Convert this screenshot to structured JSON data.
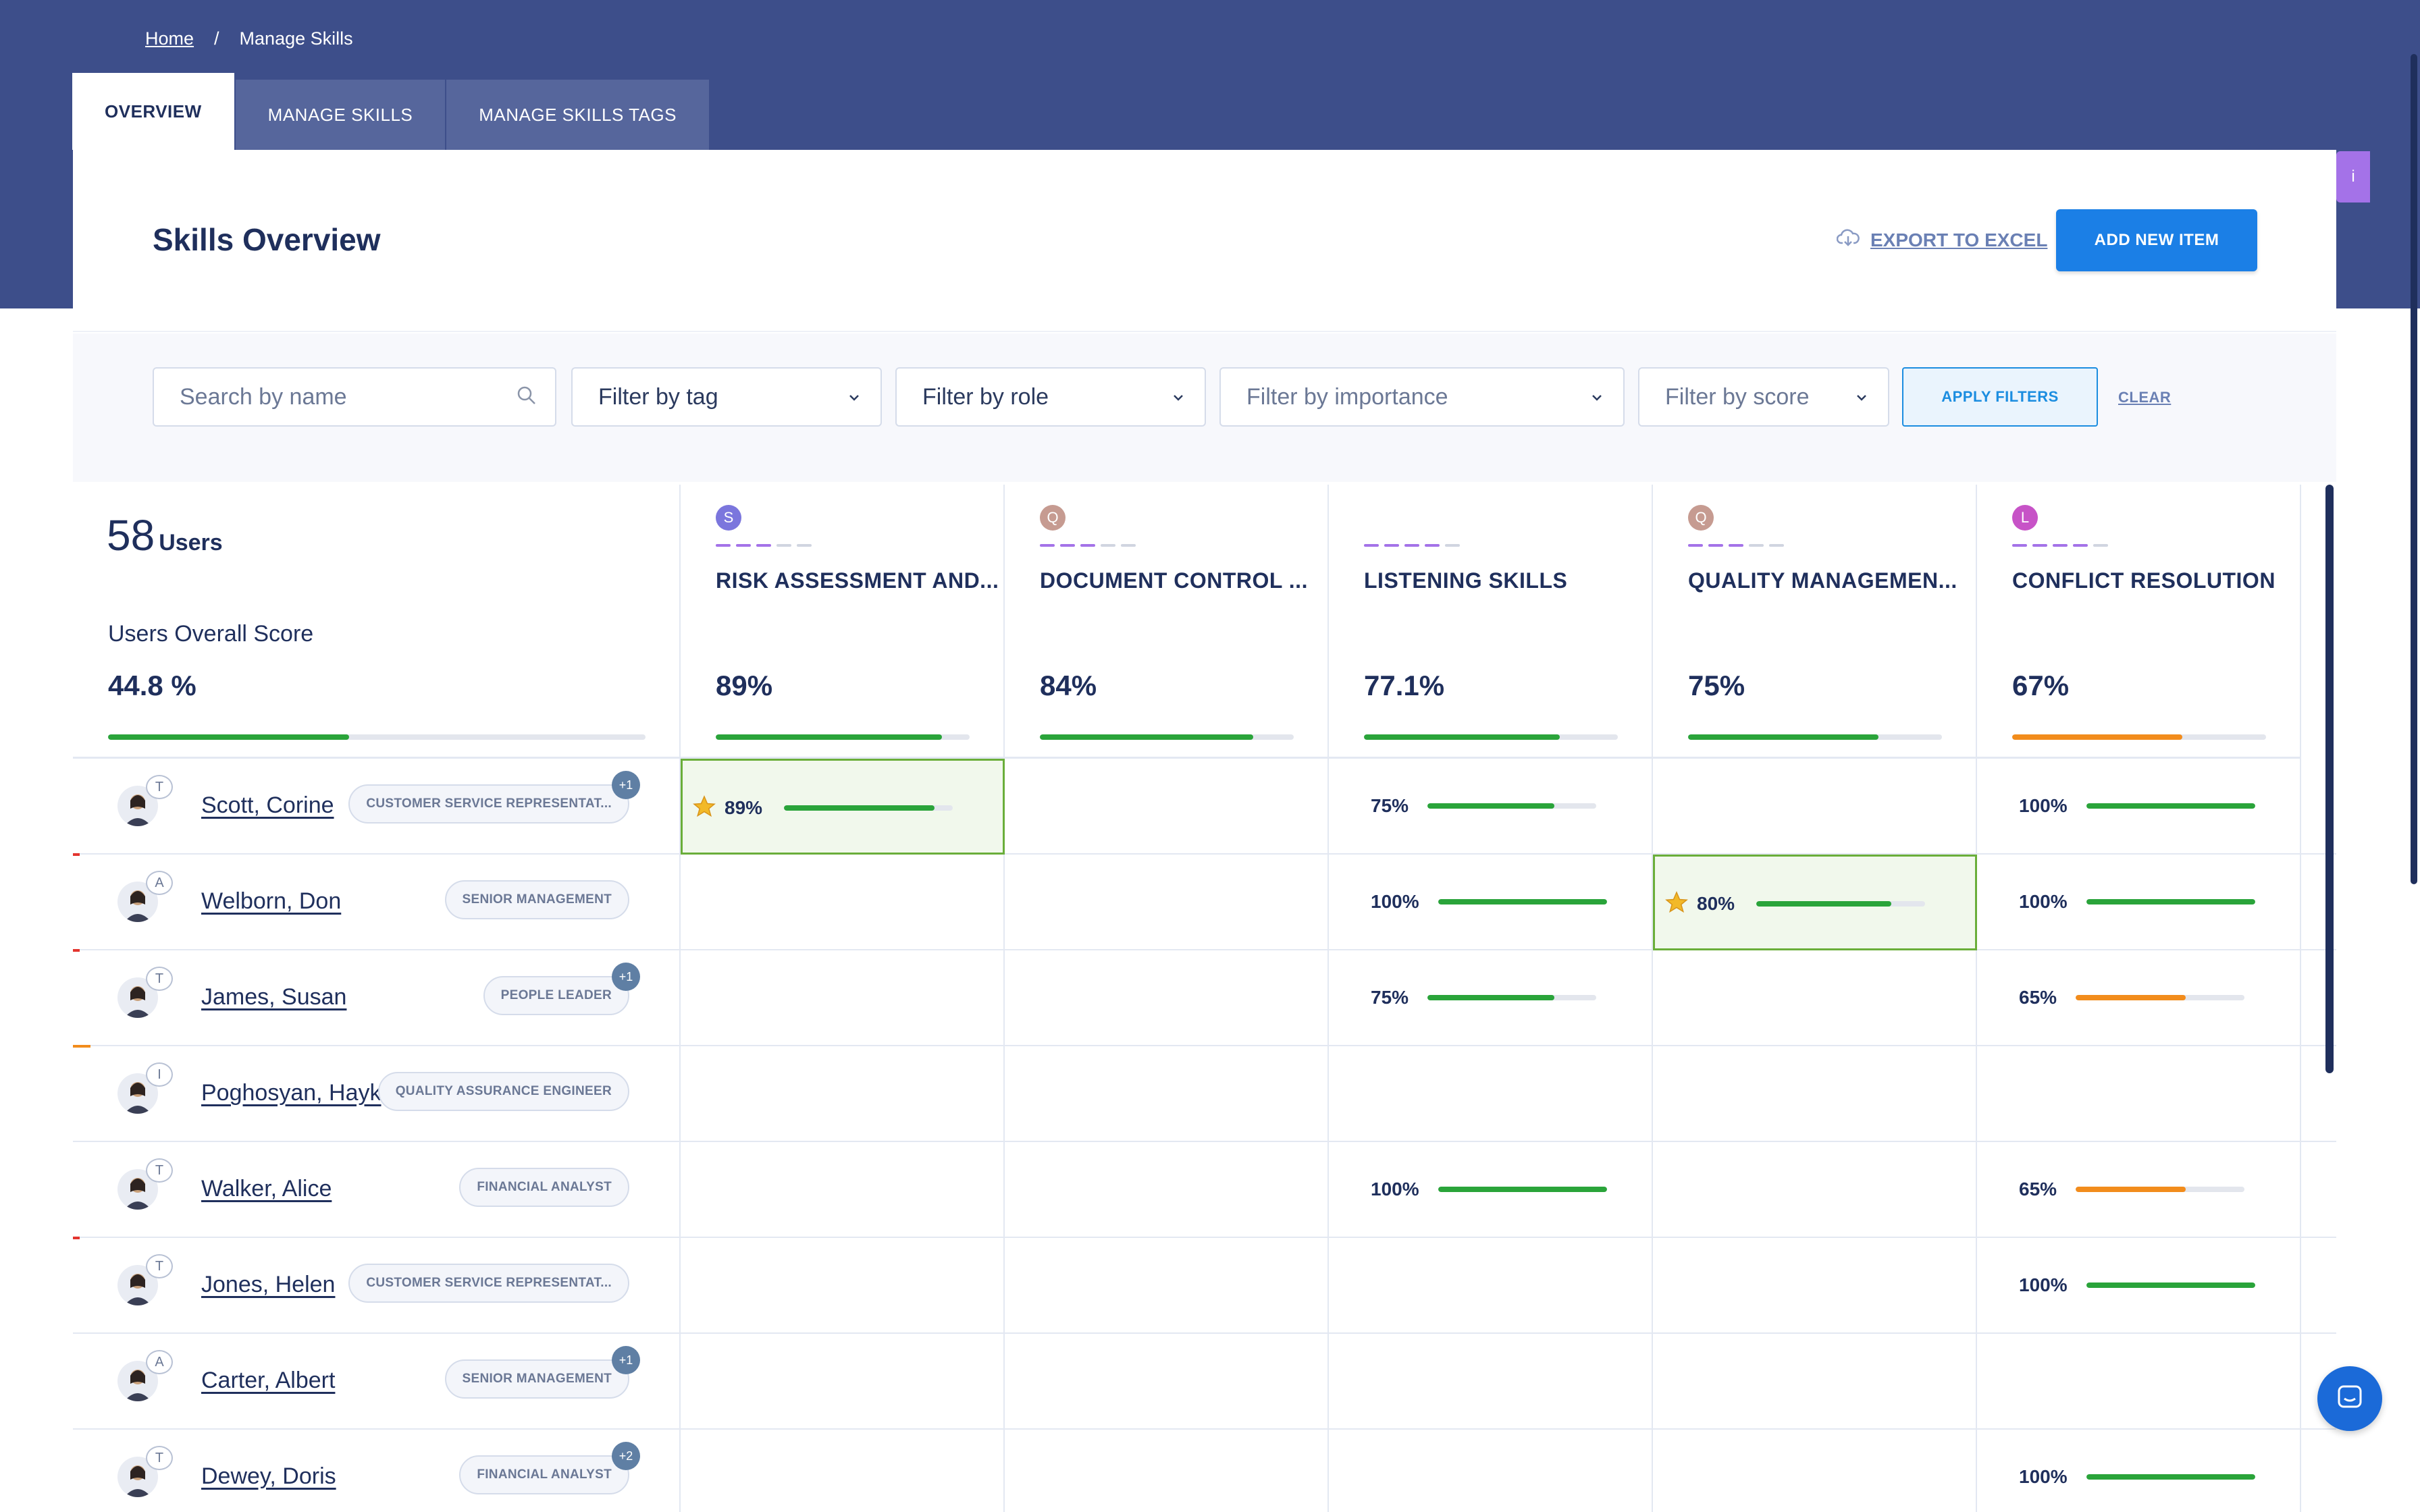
{
  "breadcrumb": {
    "home": "Home",
    "sep": "/",
    "current": "Manage Skills"
  },
  "tabs": [
    {
      "label": "OVERVIEW"
    },
    {
      "label": "MANAGE SKILLS"
    },
    {
      "label": "MANAGE SKILLS TAGS"
    }
  ],
  "side_badge": "i",
  "header": {
    "title": "Skills Overview",
    "export_label": "EXPORT TO EXCEL",
    "add_label": "ADD NEW ITEM"
  },
  "filters": {
    "search_placeholder": "Search by name",
    "tag": "Filter by tag",
    "role": "Filter by role",
    "importance": "Filter by importance",
    "score": "Filter by score",
    "apply": "APPLY FILTERS",
    "clear": "CLEAR"
  },
  "summary": {
    "count": "58",
    "count_label": "Users",
    "score_label": "Users Overall Score",
    "score_value": "44.8 %",
    "score_fraction": 0.448
  },
  "colors": {
    "header_bg": "#3d4e8a",
    "accent_blue": "#1b7fe6",
    "progress_green": "#2aa43a",
    "progress_orange": "#f28c1c",
    "highlight_green": "#6aae3a"
  },
  "skills": [
    {
      "letter": "S",
      "color": "#7b76dd",
      "name": "RISK ASSESSMENT AND...",
      "pct": "89%",
      "frac": 0.89,
      "bar": "green",
      "dashes_on": 3
    },
    {
      "letter": "Q",
      "color": "#c69b91",
      "name": "DOCUMENT CONTROL ...",
      "pct": "84%",
      "frac": 0.84,
      "bar": "green",
      "dashes_on": 3
    },
    {
      "letter": "",
      "color": "",
      "name": "LISTENING SKILLS",
      "pct": "77.1%",
      "frac": 0.771,
      "bar": "green",
      "dashes_on": 4
    },
    {
      "letter": "Q",
      "color": "#c69b91",
      "name": "QUALITY MANAGEMEN...",
      "pct": "75%",
      "frac": 0.75,
      "bar": "green",
      "dashes_on": 3
    },
    {
      "letter": "L",
      "color": "#c753c7",
      "name": "CONFLICT RESOLUTION",
      "pct": "67%",
      "frac": 0.67,
      "bar": "orange",
      "dashes_on": 4
    }
  ],
  "users": [
    {
      "name": "Scott, Corine",
      "badge": "T",
      "role": "CUSTOMER SERVICE REPRESENTAT...",
      "extra": "+1",
      "mark": "",
      "scores": [
        {
          "col": 0,
          "val": "89%",
          "frac": 0.89,
          "star": true,
          "hl": true,
          "bar": "green"
        },
        {
          "col": 2,
          "val": "75%",
          "frac": 0.75,
          "bar": "green"
        },
        {
          "col": 4,
          "val": "100%",
          "frac": 1.0,
          "bar": "green"
        }
      ]
    },
    {
      "name": "Welborn, Don",
      "badge": "A",
      "role": "SENIOR MANAGEMENT",
      "extra": "",
      "mark": "red",
      "scores": [
        {
          "col": 2,
          "val": "100%",
          "frac": 1.0,
          "bar": "green"
        },
        {
          "col": 3,
          "val": "80%",
          "frac": 0.8,
          "star": true,
          "hl": true,
          "bar": "green"
        },
        {
          "col": 4,
          "val": "100%",
          "frac": 1.0,
          "bar": "green"
        }
      ]
    },
    {
      "name": "James, Susan",
      "badge": "T",
      "role": "PEOPLE LEADER",
      "extra": "+1",
      "mark": "red",
      "scores": [
        {
          "col": 2,
          "val": "75%",
          "frac": 0.75,
          "bar": "green"
        },
        {
          "col": 4,
          "val": "65%",
          "frac": 0.65,
          "bar": "orange"
        }
      ]
    },
    {
      "name": "Poghosyan, Hayk",
      "badge": "I",
      "role": "QUALITY ASSURANCE ENGINEER",
      "extra": "",
      "mark": "orange",
      "scores": []
    },
    {
      "name": "Walker, Alice",
      "badge": "T",
      "role": "FINANCIAL ANALYST",
      "extra": "",
      "mark": "",
      "scores": [
        {
          "col": 2,
          "val": "100%",
          "frac": 1.0,
          "bar": "green"
        },
        {
          "col": 4,
          "val": "65%",
          "frac": 0.65,
          "bar": "orange"
        }
      ]
    },
    {
      "name": "Jones, Helen",
      "badge": "T",
      "role": "CUSTOMER SERVICE REPRESENTAT...",
      "extra": "",
      "mark": "red",
      "scores": [
        {
          "col": 4,
          "val": "100%",
          "frac": 1.0,
          "bar": "green"
        }
      ]
    },
    {
      "name": "Carter, Albert",
      "badge": "A",
      "role": "SENIOR MANAGEMENT",
      "extra": "+1",
      "mark": "",
      "scores": []
    },
    {
      "name": "Dewey, Doris",
      "badge": "T",
      "role": "FINANCIAL ANALYST",
      "extra": "+2",
      "mark": "",
      "scores": [
        {
          "col": 4,
          "val": "100%",
          "frac": 1.0,
          "bar": "green"
        }
      ]
    }
  ]
}
